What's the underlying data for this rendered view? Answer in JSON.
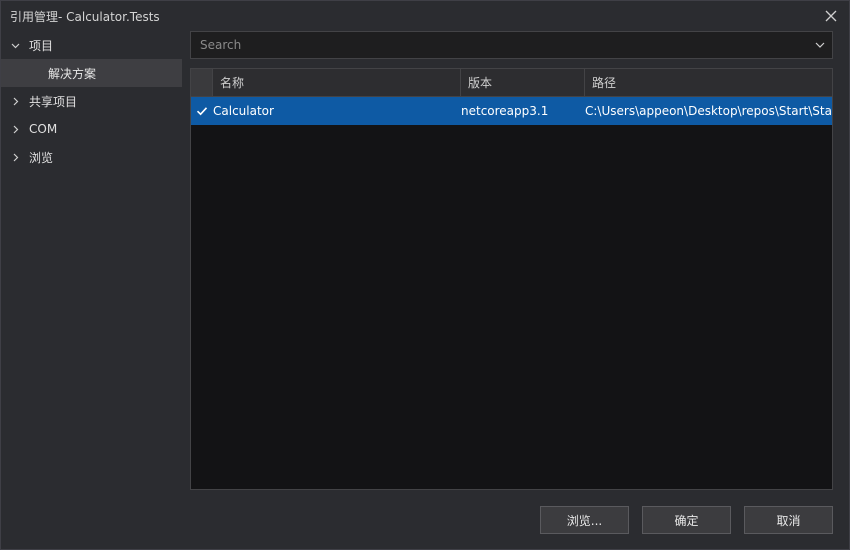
{
  "window": {
    "title": "引用管理- Calculator.Tests"
  },
  "sidebar": {
    "items": [
      {
        "label": "项目",
        "expanded": true,
        "icon": "chevron-down-icon"
      },
      {
        "label": "解决方案",
        "selected": true
      },
      {
        "label": "共享项目",
        "expanded": false,
        "icon": "chevron-right-icon"
      },
      {
        "label": "COM",
        "expanded": false,
        "icon": "chevron-right-icon"
      },
      {
        "label": "浏览",
        "expanded": false,
        "icon": "chevron-right-icon"
      }
    ]
  },
  "search": {
    "placeholder": "Search",
    "value": ""
  },
  "table": {
    "columns": [
      "名称",
      "版本",
      "路径"
    ],
    "rows": [
      {
        "checked": true,
        "name": "Calculator",
        "version": "netcoreapp3.1",
        "path": "C:\\Users\\appeon\\Desktop\\repos\\Start\\Start\\..."
      }
    ]
  },
  "buttons": {
    "browse": "浏览...",
    "ok": "确定",
    "cancel": "取消"
  },
  "colors": {
    "accent": "#0e5aa4",
    "background": "#2b2c30",
    "grid": "#131315"
  }
}
